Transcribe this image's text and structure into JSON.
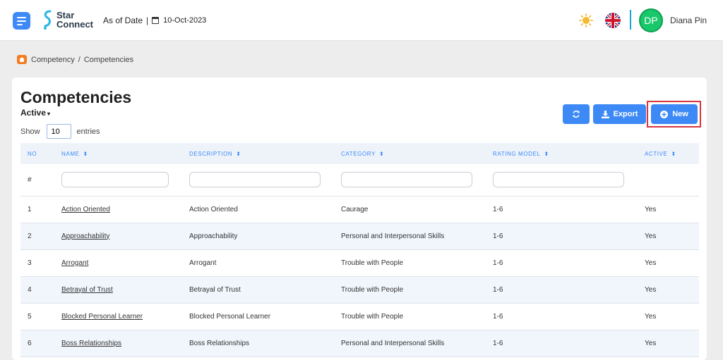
{
  "header": {
    "logo_line1": "Star",
    "logo_line2": "Connect",
    "as_of_label": "As of Date",
    "date": "10-Oct-2023",
    "avatar_initials": "DP",
    "user_name": "Diana Pin"
  },
  "breadcrumb": {
    "item1": "Competency",
    "separator": "/",
    "item2": "Competencies"
  },
  "page": {
    "title": "Competencies",
    "status_filter": "Active",
    "show_label": "Show",
    "entries_value": "10",
    "entries_label": "entries"
  },
  "toolbar": {
    "export_label": "Export",
    "new_label": "New"
  },
  "table": {
    "headers": {
      "no": "NO",
      "name": "NAME",
      "description": "DESCRIPTION",
      "category": "CATEGORY",
      "rating_model": "RATING MODEL",
      "active": "ACTIVE"
    },
    "filter_hash": "#",
    "rows": [
      {
        "no": "1",
        "name": "Action Oriented",
        "description": "Action Oriented",
        "category": "Caurage",
        "rating": "1-6",
        "active": "Yes"
      },
      {
        "no": "2",
        "name": "Approachability",
        "description": "Approachability",
        "category": "Personal and Interpersonal Skills",
        "rating": "1-6",
        "active": "Yes"
      },
      {
        "no": "3",
        "name": "Arrogant",
        "description": "Arrogant",
        "category": "Trouble with People",
        "rating": "1-6",
        "active": "Yes"
      },
      {
        "no": "4",
        "name": "Betrayal of Trust",
        "description": "Betrayal of Trust",
        "category": "Trouble with People",
        "rating": "1-6",
        "active": "Yes"
      },
      {
        "no": "5",
        "name": "Blocked Personal Learner",
        "description": "Blocked Personal Learner",
        "category": "Trouble with People",
        "rating": "1-6",
        "active": "Yes"
      },
      {
        "no": "6",
        "name": "Boss Relationships",
        "description": "Boss Relationships",
        "category": "Personal and Interpersonal Skills",
        "rating": "1-6",
        "active": "Yes"
      }
    ]
  },
  "colors": {
    "accent": "#3d8af7",
    "avatar": "#19c86b",
    "highlight": "#d9363e"
  }
}
